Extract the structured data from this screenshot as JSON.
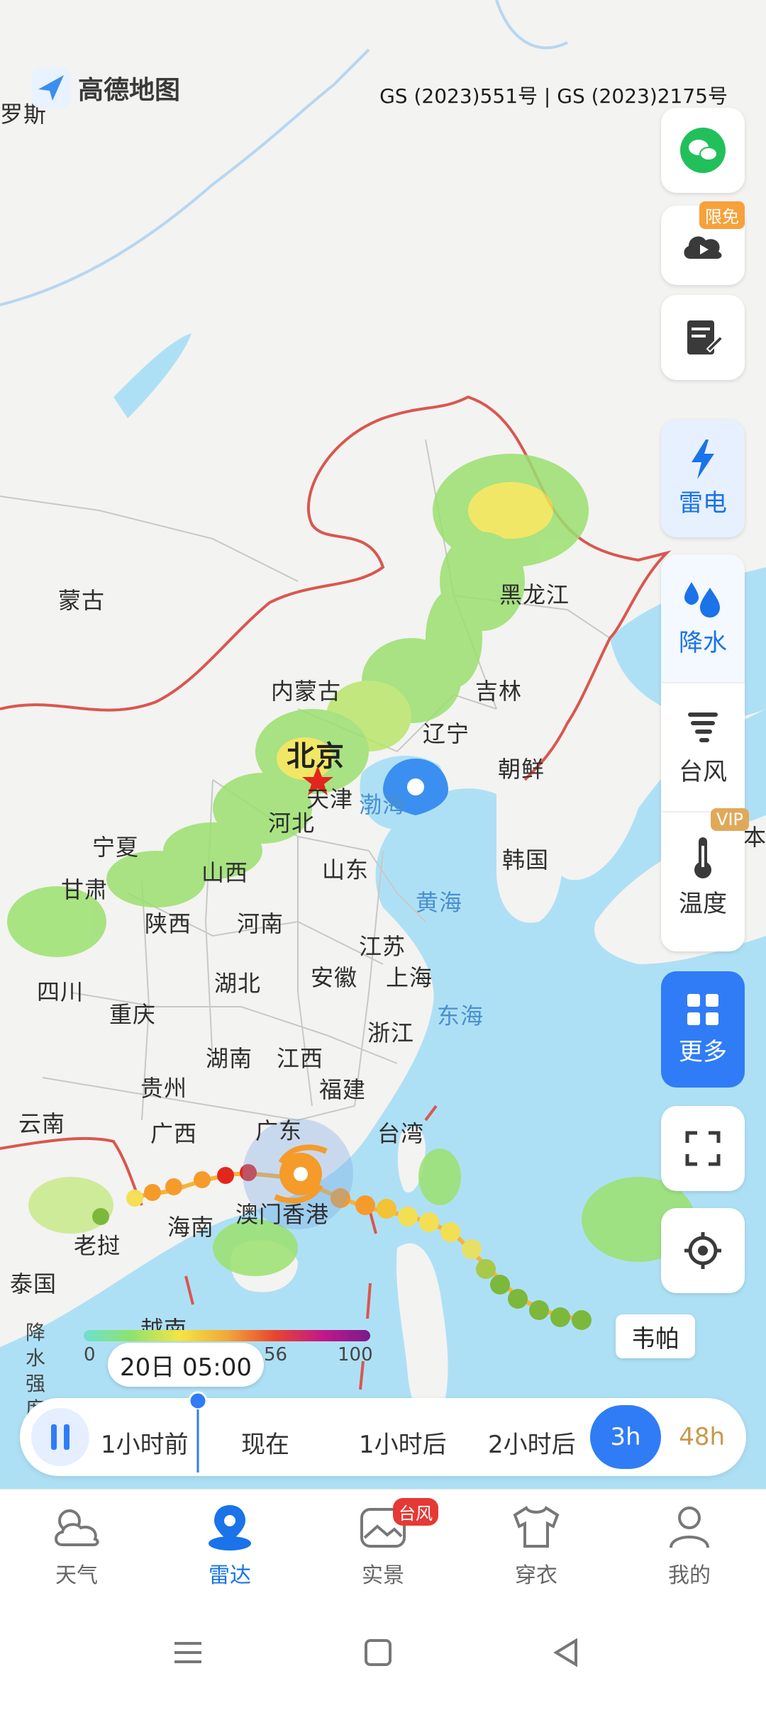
{
  "app": {
    "logo_text": "高德地图",
    "approval_number": "GS (2023)551号 | GS (2023)2175号"
  },
  "map_labels": {
    "russia_partial": "罗斯",
    "mongolia": "蒙古",
    "inner_mongolia": "内蒙古",
    "heilongjiang": "黑龙江",
    "jilin": "吉林",
    "liaoning": "辽宁",
    "north_korea": "朝鲜",
    "beijing": "北京",
    "tianjin": "天津",
    "hebei": "河北",
    "bohai": "渤海",
    "ningxia": "宁夏",
    "shanxi": "山西",
    "shandong": "山东",
    "south_korea": "韩国",
    "gansu": "甘肃",
    "shaanxi": "陕西",
    "henan": "河南",
    "yellow_sea": "黄海",
    "jiangsu": "江苏",
    "anhui": "安徽",
    "shanghai": "上海",
    "sichuan": "四川",
    "hubei": "湖北",
    "chongqing": "重庆",
    "east_sea": "东海",
    "zhejiang": "浙江",
    "hunan": "湖南",
    "jiangxi": "江西",
    "guizhou": "贵州",
    "fujian": "福建",
    "yunnan": "云南",
    "guangxi": "广西",
    "guangdong": "广东",
    "taiwan": "台湾",
    "hainan": "海南",
    "macau_hongkong": "澳门香港",
    "laos": "老挝",
    "thailand": "泰国",
    "vietnam_partial": "越南",
    "japan_partial": "本"
  },
  "typhoon": {
    "name": "韦帕"
  },
  "side_tools": {
    "wechat_label": "",
    "cloud_badge": "限免",
    "thunder_label": "雷电",
    "precip_label": "降水",
    "typhoon_label": "台风",
    "temp_label": "温度",
    "temp_badge": "VIP",
    "more_label": "更多"
  },
  "legend": {
    "title_line1": "降水",
    "title_line2": "强度",
    "tick_min": "0",
    "tick_mid": "56",
    "tick_max": "100"
  },
  "time_chip": "20日 05:00",
  "timeline": {
    "labels": [
      "1小时前",
      "现在",
      "1小时后",
      "2小时后"
    ],
    "range_active": "3h",
    "range_other": "48h"
  },
  "bottom_nav": {
    "items": [
      {
        "label": "天气"
      },
      {
        "label": "雷达"
      },
      {
        "label": "实景",
        "badge": "台风"
      },
      {
        "label": "穿衣"
      },
      {
        "label": "我的"
      }
    ]
  },
  "colors": {
    "accent": "#2f7cf6",
    "sea": "#aee0f5",
    "border_red": "#d9574f",
    "track_red": "#e3261c",
    "track_orange": "#f59b2a",
    "track_yellow": "#f3df53",
    "track_green": "#7cb83c"
  }
}
